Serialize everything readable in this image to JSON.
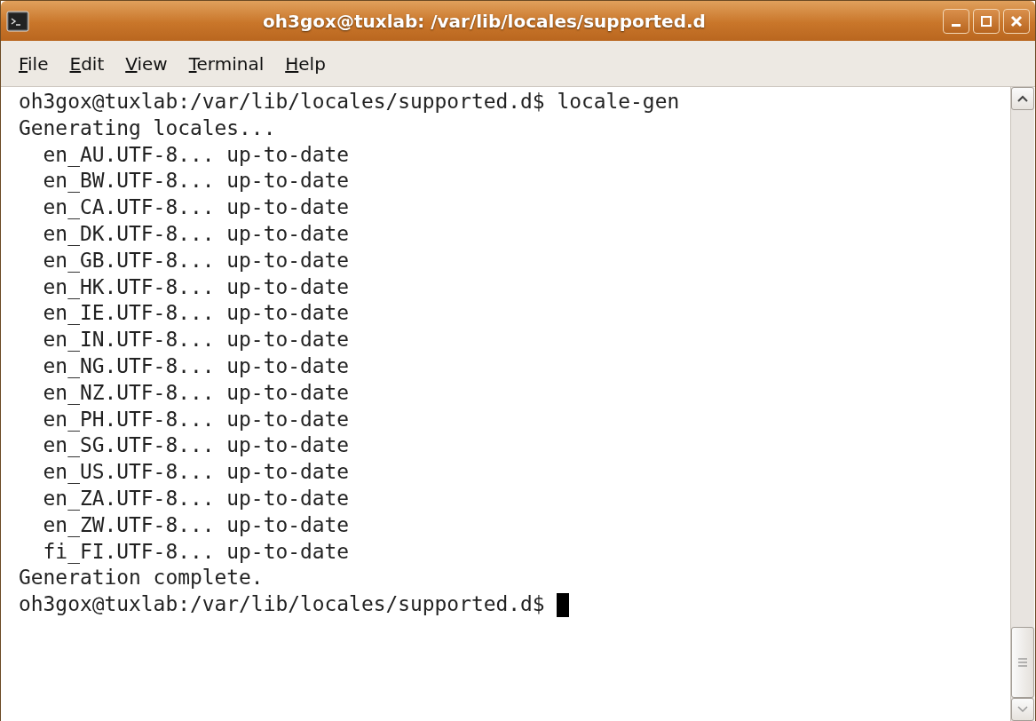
{
  "window": {
    "title": "oh3gox@tuxlab: /var/lib/locales/supported.d"
  },
  "menu": [
    "File",
    "Edit",
    "View",
    "Terminal",
    "Help"
  ],
  "terminal": {
    "lines": [
      "oh3gox@tuxlab:/var/lib/locales/supported.d$ locale-gen",
      "Generating locales...",
      "  en_AU.UTF-8... up-to-date",
      "  en_BW.UTF-8... up-to-date",
      "  en_CA.UTF-8... up-to-date",
      "  en_DK.UTF-8... up-to-date",
      "  en_GB.UTF-8... up-to-date",
      "  en_HK.UTF-8... up-to-date",
      "  en_IE.UTF-8... up-to-date",
      "  en_IN.UTF-8... up-to-date",
      "  en_NG.UTF-8... up-to-date",
      "  en_NZ.UTF-8... up-to-date",
      "  en_PH.UTF-8... up-to-date",
      "  en_SG.UTF-8... up-to-date",
      "  en_US.UTF-8... up-to-date",
      "  en_ZA.UTF-8... up-to-date",
      "  en_ZW.UTF-8... up-to-date",
      "  fi_FI.UTF-8... up-to-date",
      "Generation complete.",
      "oh3gox@tuxlab:/var/lib/locales/supported.d$"
    ],
    "cursor_visible": true
  }
}
